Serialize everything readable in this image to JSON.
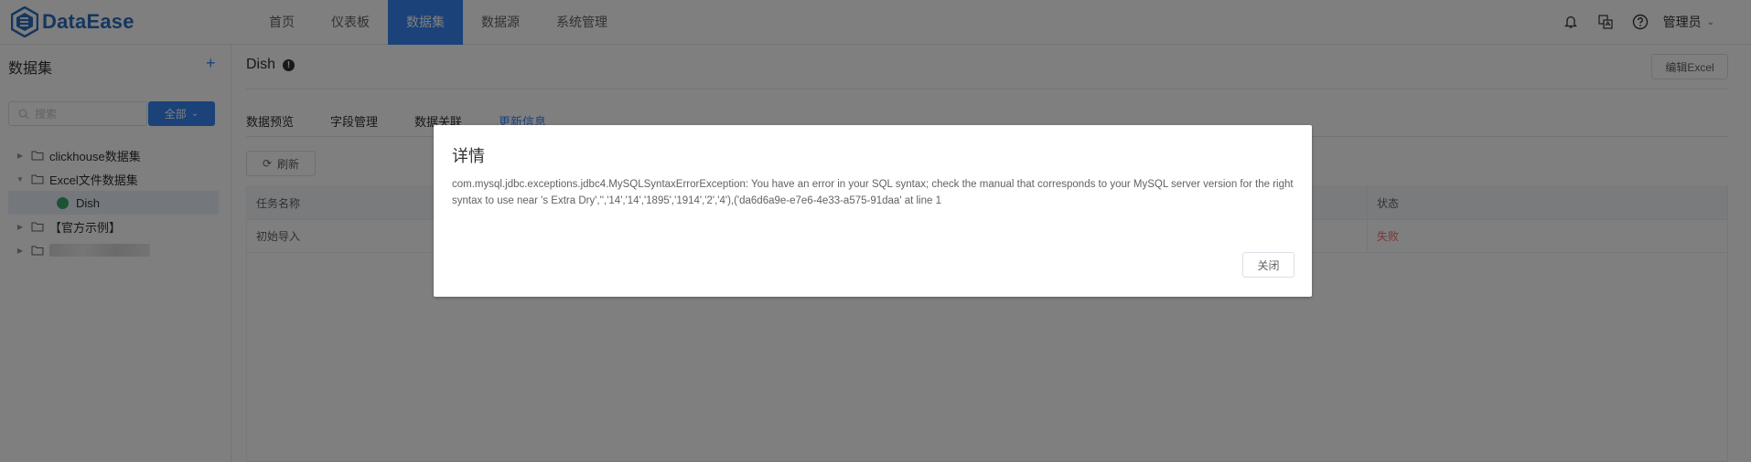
{
  "app": {
    "name": "DataEase"
  },
  "nav": [
    {
      "label": "首页",
      "active": false
    },
    {
      "label": "仪表板",
      "active": false
    },
    {
      "label": "数据集",
      "active": true
    },
    {
      "label": "数据源",
      "active": false
    },
    {
      "label": "系统管理",
      "active": false
    }
  ],
  "header": {
    "user": "管理员"
  },
  "sidebar": {
    "title": "数据集",
    "add": "+",
    "search_placeholder": "搜索",
    "filter_label": "全部",
    "tree": [
      {
        "label": "clickhouse数据集",
        "type": "folder",
        "expanded": false
      },
      {
        "label": "Excel文件数据集",
        "type": "folder",
        "expanded": true
      },
      {
        "label": "Dish",
        "type": "dataset",
        "selected": true
      },
      {
        "label": "【官方示例】",
        "type": "folder",
        "expanded": false
      }
    ]
  },
  "main": {
    "title": "Dish",
    "info_mark": "!",
    "edit_button": "编辑Excel",
    "tabs": [
      {
        "label": "数据预览",
        "active": false
      },
      {
        "label": "字段管理",
        "active": false
      },
      {
        "label": "数据关联",
        "active": false
      },
      {
        "label": "更新信息",
        "active": true
      }
    ],
    "refresh_label": "刷新",
    "table": {
      "columns": [
        "任务名称",
        "状态"
      ],
      "rows": [
        {
          "name": "初始导入",
          "status": "失败"
        }
      ]
    }
  },
  "dialog": {
    "title": "详情",
    "message": "com.mysql.jdbc.exceptions.jdbc4.MySQLSyntaxErrorException: You have an error in your SQL syntax; check the manual that corresponds to your MySQL server version for the right syntax to use near 's Extra Dry','','14','14','1895','1914','2','4'),('da6d6a9e-e7e6-4e33-a575-91daa' at line 1",
    "close_label": "关闭"
  },
  "colors": {
    "accent": "#3685f2",
    "fail": "#f56c6c",
    "dataset_icon": "#3ba66b"
  }
}
